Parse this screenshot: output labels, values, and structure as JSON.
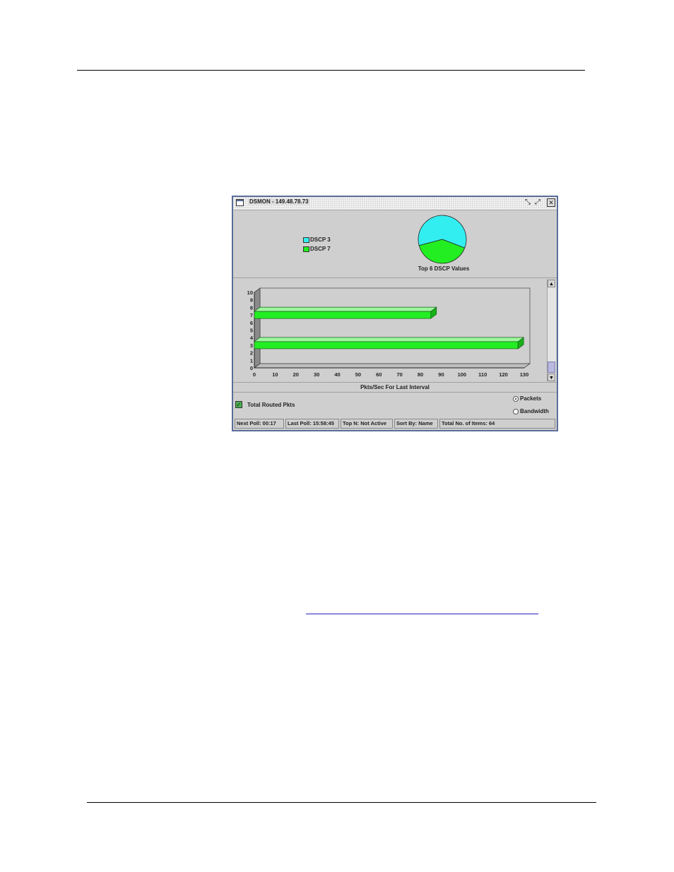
{
  "window": {
    "title": "DSMON - 149.48.78.73"
  },
  "pie": {
    "title": "Top 6 DSCP Values",
    "legend": [
      {
        "label": "DSCP 3",
        "color": "#33eef0"
      },
      {
        "label": "DSCP 7",
        "color": "#22ee22"
      }
    ],
    "slices": [
      {
        "label": "DSCP 3",
        "value": 60,
        "color": "#33eef0"
      },
      {
        "label": "DSCP 7",
        "value": 40,
        "color": "#22ee22"
      }
    ]
  },
  "chart_data": {
    "type": "bar",
    "orientation": "horizontal",
    "xlabel": "Pkts/Sec For Last Interval",
    "xlim": [
      0,
      130
    ],
    "ylim": [
      0,
      10
    ],
    "x_ticks": [
      "0",
      "10",
      "20",
      "30",
      "40",
      "50",
      "60",
      "70",
      "80",
      "90",
      "100",
      "110",
      "120",
      "130"
    ],
    "y_ticks": [
      "0",
      "1",
      "2",
      "3",
      "4",
      "5",
      "6",
      "7",
      "8",
      "9",
      "10"
    ],
    "bars": [
      {
        "y": 7,
        "value": 85,
        "color": "#22ee22"
      },
      {
        "y": 3,
        "value": 127,
        "color": "#22ee22"
      }
    ]
  },
  "controls": {
    "checkbox_label": "Total Routed Pkts",
    "radio_packets": "Packets",
    "radio_bandwidth": "Bandwidth",
    "selected": "Packets"
  },
  "status": {
    "next_poll": "Next Poll:  00:17",
    "last_poll": "Last Poll: 15:58:45",
    "top_n": "Top N: Not Active",
    "sort_by": "Sort By: Name",
    "total_items": "Total No. of Items: 64"
  },
  "colors": {
    "window_border": "#5a6d9a",
    "panel_bg": "#cfcfcf"
  }
}
